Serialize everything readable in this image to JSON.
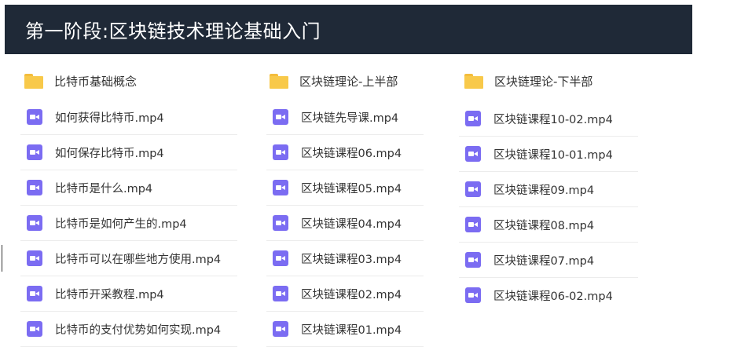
{
  "header": {
    "title": "第一阶段:区块链技术理论基础入门"
  },
  "columns": [
    {
      "folder": "比特币基础概念",
      "files": [
        "如何获得比特币.mp4",
        "如何保存比特币.mp4",
        "比特币是什么.mp4",
        "比特币是如何产生的.mp4",
        "比特币可以在哪些地方使用.mp4",
        "比特币开采教程.mp4",
        "比特币的支付优势如何实现.mp4"
      ]
    },
    {
      "folder": "区块链理论-上半部",
      "files": [
        "区块链先导课.mp4",
        "区块链课程06.mp4",
        "区块链课程05.mp4",
        "区块链课程04.mp4",
        "区块链课程03.mp4",
        "区块链课程02.mp4",
        "区块链课程01.mp4"
      ]
    },
    {
      "folder": "区块链理论-下半部",
      "files": [
        "区块链课程10-02.mp4",
        "区块链课程10-01.mp4",
        "区块链课程09.mp4",
        "区块链课程08.mp4",
        "区块链课程07.mp4",
        "区块链课程06-02.mp4"
      ]
    }
  ],
  "colors": {
    "header_bg": "#1f2937",
    "folder": "#f8c94a",
    "video_icon": "#7b6cf2"
  }
}
